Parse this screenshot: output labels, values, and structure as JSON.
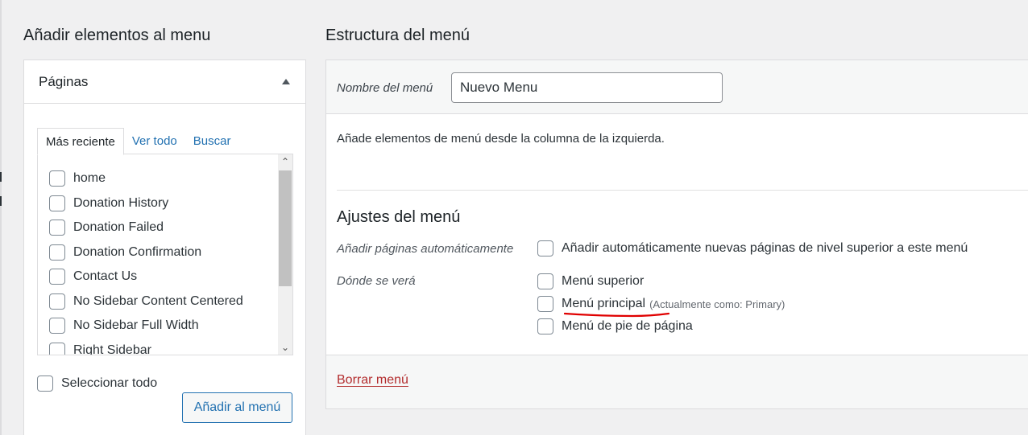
{
  "left": {
    "title": "Añadir elementos al menu",
    "panel_title": "Páginas",
    "tabs": [
      "Más reciente",
      "Ver todo",
      "Buscar"
    ],
    "pages": [
      "home",
      "Donation History",
      "Donation Failed",
      "Donation Confirmation",
      "Contact Us",
      "No Sidebar Content Centered",
      "No Sidebar Full Width",
      "Right Sidebar"
    ],
    "select_all": "Seleccionar todo",
    "add_button": "Añadir al menú"
  },
  "right": {
    "title": "Estructura del menú",
    "name_label": "Nombre del menú",
    "name_value": "Nuevo Menu",
    "hint": "Añade elementos de menú desde la columna de la izquierda.",
    "settings_title": "Ajustes del menú",
    "auto_add_label": "Añadir páginas automáticamente",
    "auto_add_option": "Añadir automáticamente nuevas páginas de nivel superior a este menú",
    "locations_label": "Dónde se verá",
    "locations": [
      {
        "label": "Menú superior",
        "note": ""
      },
      {
        "label": "Menú principal",
        "note": "(Actualmente como: Primary)"
      },
      {
        "label": "Menú de pie de página",
        "note": ""
      }
    ],
    "delete_link": "Borrar menú"
  },
  "colors": {
    "accent": "#2271b1",
    "danger": "#b32d2e",
    "annotation": "#e00000"
  }
}
